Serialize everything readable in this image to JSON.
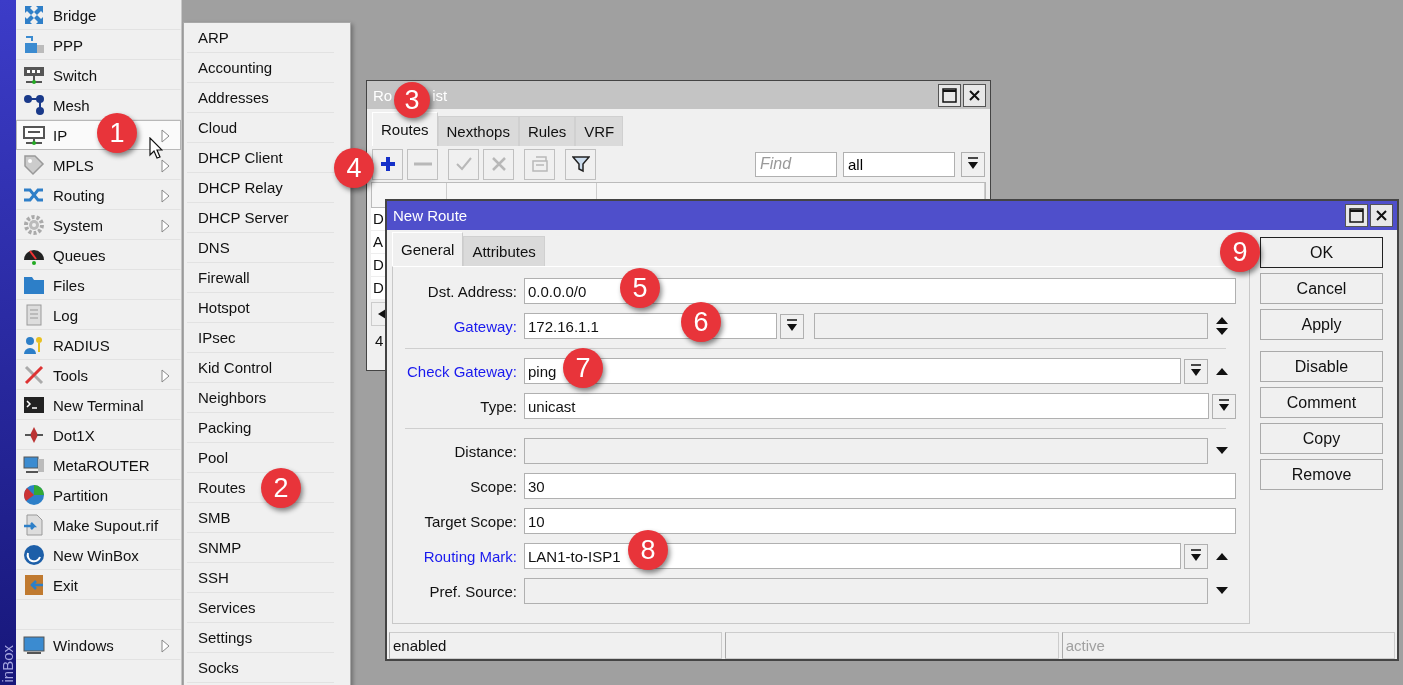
{
  "side_label": "inBox",
  "main_menu": {
    "items": [
      {
        "label": "Bridge",
        "submenu": false,
        "selected": false
      },
      {
        "label": "PPP",
        "submenu": false,
        "selected": false
      },
      {
        "label": "Switch",
        "submenu": false,
        "selected": false
      },
      {
        "label": "Mesh",
        "submenu": false,
        "selected": false
      },
      {
        "label": "IP",
        "submenu": true,
        "selected": true
      },
      {
        "label": "MPLS",
        "submenu": true,
        "selected": false
      },
      {
        "label": "Routing",
        "submenu": true,
        "selected": false
      },
      {
        "label": "System",
        "submenu": true,
        "selected": false
      },
      {
        "label": "Queues",
        "submenu": false,
        "selected": false
      },
      {
        "label": "Files",
        "submenu": false,
        "selected": false
      },
      {
        "label": "Log",
        "submenu": false,
        "selected": false
      },
      {
        "label": "RADIUS",
        "submenu": false,
        "selected": false
      },
      {
        "label": "Tools",
        "submenu": true,
        "selected": false
      },
      {
        "label": "New Terminal",
        "submenu": false,
        "selected": false
      },
      {
        "label": "Dot1X",
        "submenu": false,
        "selected": false
      },
      {
        "label": "MetaROUTER",
        "submenu": false,
        "selected": false
      },
      {
        "label": "Partition",
        "submenu": false,
        "selected": false
      },
      {
        "label": "Make Supout.rif",
        "submenu": false,
        "selected": false
      },
      {
        "label": "New WinBox",
        "submenu": false,
        "selected": false
      },
      {
        "label": "Exit",
        "submenu": false,
        "selected": false
      }
    ],
    "bottom_items": [
      {
        "label": "Windows",
        "submenu": true,
        "selected": false
      }
    ]
  },
  "ip_submenu": {
    "items": [
      "ARP",
      "Accounting",
      "Addresses",
      "Cloud",
      "DHCP Client",
      "DHCP Relay",
      "DHCP Server",
      "DNS",
      "Firewall",
      "Hotspot",
      "IPsec",
      "Kid Control",
      "Neighbors",
      "Packing",
      "Pool",
      "Routes",
      "SMB",
      "SNMP",
      "SSH",
      "Services",
      "Settings",
      "Socks"
    ]
  },
  "route_list": {
    "title_fragments": [
      "Ro",
      "ist"
    ],
    "tabs": [
      {
        "label": "Routes",
        "selected": true
      },
      {
        "label": "Nexthops",
        "selected": false
      },
      {
        "label": "Rules",
        "selected": false
      },
      {
        "label": "VRF",
        "selected": false
      }
    ],
    "toolbar": [
      {
        "kind": "add",
        "disabled": false
      },
      {
        "kind": "remove",
        "disabled": true
      },
      {
        "kind": "enable",
        "disabled": true
      },
      {
        "kind": "disable",
        "disabled": true
      },
      {
        "kind": "comment",
        "disabled": true
      },
      {
        "kind": "filter",
        "disabled": false
      }
    ],
    "find": {
      "placeholder": "Find"
    },
    "filter": {
      "value": "all"
    },
    "rows": [
      {
        "flag": "D"
      },
      {
        "flag": "A"
      },
      {
        "flag": "D"
      },
      {
        "flag": "D"
      }
    ],
    "count": "4"
  },
  "new_route": {
    "title": "New Route",
    "tabs": [
      {
        "label": "General",
        "selected": true
      },
      {
        "label": "Attributes",
        "selected": false
      }
    ],
    "fields": [
      {
        "kind": "text",
        "label": "Dst. Address:",
        "link": false,
        "value": "0.0.0.0/0"
      },
      {
        "kind": "gateway",
        "label": "Gateway:",
        "link": true,
        "value": "172.16.1.1"
      },
      {
        "kind": "separator"
      },
      {
        "kind": "select_arrow",
        "label": "Check Gateway:",
        "link": true,
        "value": "ping"
      },
      {
        "kind": "select",
        "label": "Type:",
        "link": false,
        "value": "unicast"
      },
      {
        "kind": "separator"
      },
      {
        "kind": "empty_arrow",
        "label": "Distance:",
        "link": false
      },
      {
        "kind": "text",
        "label": "Scope:",
        "link": false,
        "value": "30"
      },
      {
        "kind": "text",
        "label": "Target Scope:",
        "link": false,
        "value": "10"
      },
      {
        "kind": "select_arrow",
        "label": "Routing Mark:",
        "link": true,
        "value": "LAN1-to-ISP1"
      },
      {
        "kind": "empty_arrow",
        "label": "Pref. Source:",
        "link": false
      }
    ],
    "button_groups": [
      [
        {
          "label": "OK",
          "default": true
        },
        {
          "label": "Cancel",
          "default": false
        },
        {
          "label": "Apply",
          "default": false
        }
      ],
      [
        {
          "label": "Disable",
          "default": false
        },
        {
          "label": "Comment",
          "default": false
        },
        {
          "label": "Copy",
          "default": false
        },
        {
          "label": "Remove",
          "default": false
        }
      ]
    ],
    "status_cells": [
      {
        "kind": "text",
        "text": "enabled",
        "dimmed": false
      },
      {
        "kind": "empty"
      },
      {
        "kind": "text",
        "text": "active",
        "dimmed": true
      }
    ]
  },
  "callouts": [
    "1",
    "2",
    "3",
    "4",
    "5",
    "6",
    "7",
    "8",
    "9"
  ]
}
